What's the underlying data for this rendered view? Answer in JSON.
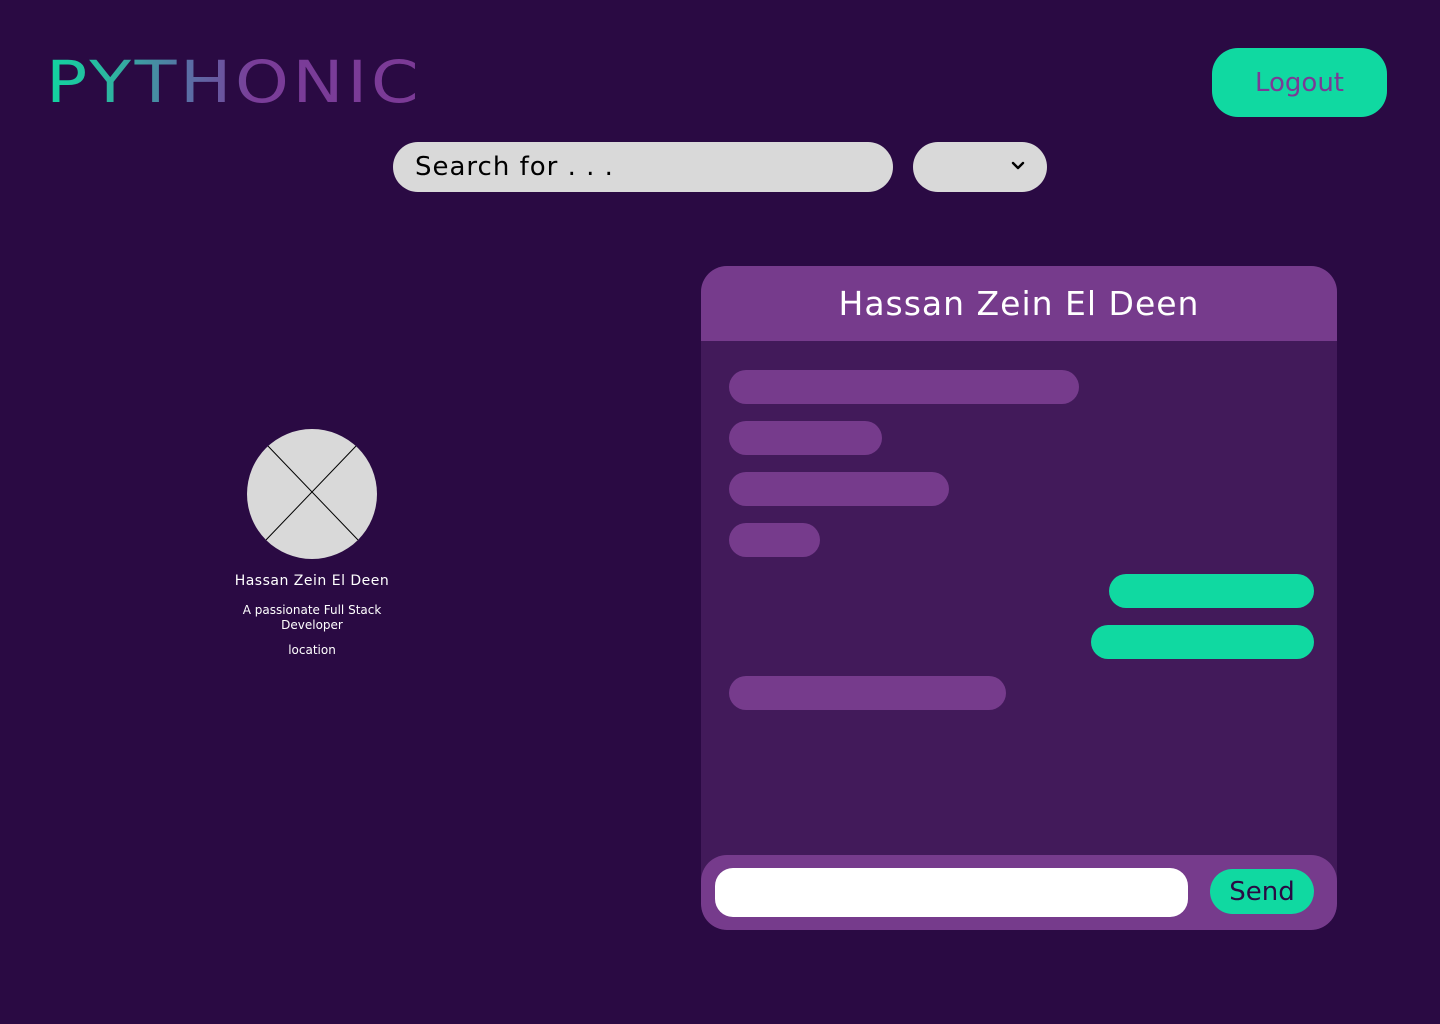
{
  "brand": {
    "logo_text": "PYTHONIC"
  },
  "header": {
    "logout_label": "Logout"
  },
  "search": {
    "placeholder": "Search for . . .",
    "filter_selected": ""
  },
  "profile": {
    "name": "Hassan Zein El Deen",
    "bio": "A passionate Full Stack Developer",
    "location": "location"
  },
  "chat": {
    "title": "Hassan Zein El Deen",
    "messages": [
      {
        "direction": "incoming",
        "text": ""
      },
      {
        "direction": "incoming",
        "text": ""
      },
      {
        "direction": "incoming",
        "text": ""
      },
      {
        "direction": "incoming",
        "text": ""
      },
      {
        "direction": "outgoing",
        "text": ""
      },
      {
        "direction": "outgoing",
        "text": ""
      },
      {
        "direction": "incoming",
        "text": ""
      }
    ],
    "input_value": "",
    "send_label": "Send"
  },
  "colors": {
    "background": "#2a0a43",
    "accent": "#10d9a1",
    "purple": "#763b8c",
    "panel": "#421a5a",
    "field": "#d9d9d9"
  },
  "icons": {
    "dropdown": "chevron-down-icon",
    "avatar": "image-placeholder-icon"
  }
}
